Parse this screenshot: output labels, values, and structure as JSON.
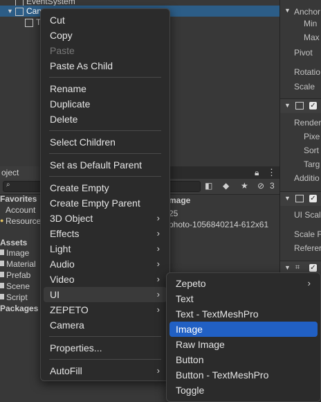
{
  "hierarchy": {
    "rows": [
      "EventSystem",
      "Can",
      "T"
    ]
  },
  "inspector": {
    "labels": [
      "Anchor",
      "Min",
      "Max",
      "Pivot",
      "Rotatio",
      "Scale",
      "Render",
      "Pixe",
      "Sort",
      "Targ",
      "Additio",
      "UI Scal",
      "Scale F",
      "Referer"
    ]
  },
  "project": {
    "tab_label": "oject",
    "favorites_label": "Favorites",
    "favorites": [
      "Account",
      "Resource"
    ],
    "assets_label": "Assets",
    "assets": [
      "Image",
      "Material",
      "Prefab",
      "Scene",
      "Script"
    ],
    "packages_label": "Packages",
    "badge_count": "3",
    "detail_header": "mage",
    "detail_line1": "25",
    "detail_line2": "photo-1056840214-612x61"
  },
  "context_menu": {
    "items": [
      "Cut",
      "Copy",
      "Paste",
      "Paste As Child",
      "Rename",
      "Duplicate",
      "Delete",
      "Select Children",
      "Set as Default Parent",
      "Create Empty",
      "Create Empty Parent",
      "3D Object",
      "Effects",
      "Light",
      "Audio",
      "Video",
      "UI",
      "ZEPETO",
      "Camera",
      "Properties...",
      "AutoFill"
    ]
  },
  "ui_submenu": {
    "items": [
      "Zepeto",
      "Text",
      "Text - TextMeshPro",
      "Image",
      "Raw Image",
      "Button",
      "Button - TextMeshPro",
      "Toggle"
    ]
  },
  "icons": {
    "submenu_arrow": "›",
    "check": "✓"
  },
  "colors": {
    "selection_blue": "#2160c4",
    "hierarchy_selected": "#2c5d87",
    "menu_bg": "#2b2b2b"
  }
}
